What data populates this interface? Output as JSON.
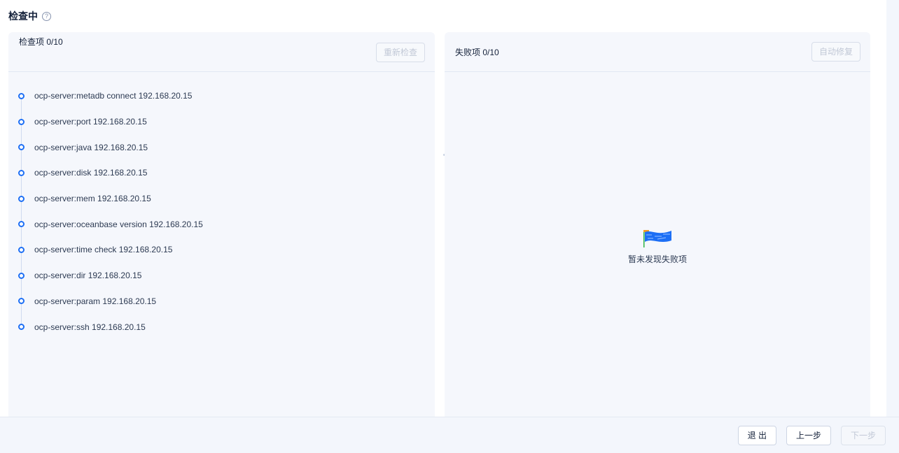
{
  "header": {
    "title": "检查中",
    "help_icon": "question-circle-icon"
  },
  "check_panel": {
    "title": "检查项 0/10",
    "recheck_label": "重新检查",
    "items": [
      "ocp-server:metadb connect 192.168.20.15",
      "ocp-server:port 192.168.20.15",
      "ocp-server:java 192.168.20.15",
      "ocp-server:disk 192.168.20.15",
      "ocp-server:mem 192.168.20.15",
      "ocp-server:oceanbase version 192.168.20.15",
      "ocp-server:time check 192.168.20.15",
      "ocp-server:dir 192.168.20.15",
      "ocp-server:param 192.168.20.15",
      "ocp-server:ssh 192.168.20.15"
    ]
  },
  "fail_panel": {
    "title": "失败项 0/10",
    "auto_fix_label": "自动修复",
    "empty_text": "暂未发现失败项",
    "empty_icon": "flag-illustration-icon"
  },
  "footer": {
    "exit_label": "退 出",
    "prev_label": "上一步",
    "next_label": "下一步"
  },
  "colors": {
    "accent": "#1d6ff5",
    "panel_bg": "#f5f7fc",
    "page_bg": "#f3f6fc"
  }
}
